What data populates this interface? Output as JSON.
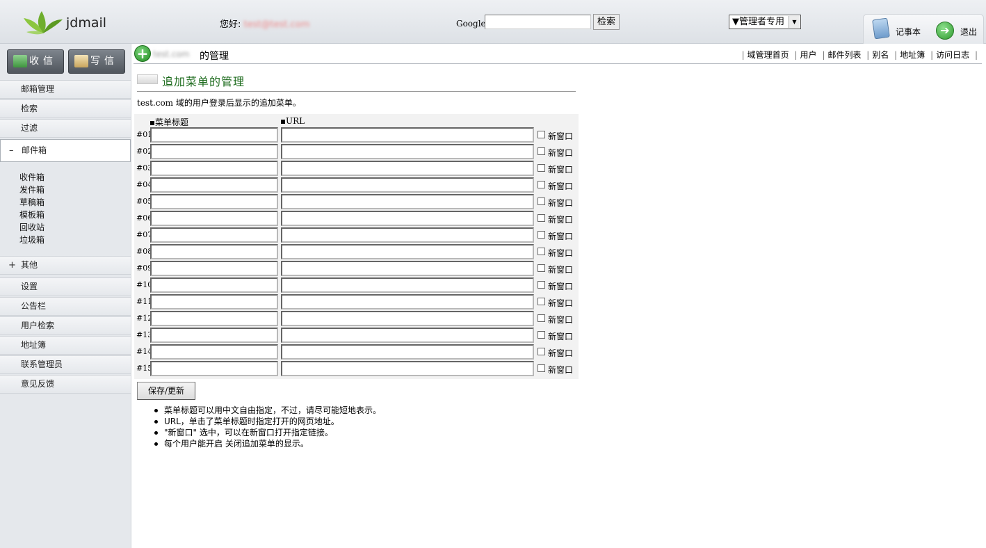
{
  "header": {
    "logo_text": "jdmail",
    "greeting_label": "您好:",
    "user_email": "test@test.com",
    "google_label": "Google",
    "search_button": "检索",
    "admin_select": "▼管理者专用",
    "notepad_label": "记事本",
    "logout_label": "退出"
  },
  "sidebar": {
    "receive_label": "收信",
    "write_label": "写信",
    "items": [
      {
        "label": "邮箱管理"
      },
      {
        "label": "检索"
      },
      {
        "label": "过滤"
      },
      {
        "label": "邮件箱",
        "sign": "–"
      },
      {
        "label": "其他",
        "sign": "+"
      },
      {
        "label": "设置"
      },
      {
        "label": "公告栏"
      },
      {
        "label": "用户检索"
      },
      {
        "label": "地址簿"
      },
      {
        "label": "联系管理员"
      },
      {
        "label": "意见反馈"
      }
    ],
    "folders": [
      "收件箱",
      "发件箱",
      "草稿箱",
      "模板箱",
      "回收站",
      "垃圾箱"
    ]
  },
  "content": {
    "domain": "test.com",
    "head_title": "的管理",
    "links": [
      "域管理首页",
      "用户",
      "邮件列表",
      "别名",
      "地址簿",
      "访问日志"
    ],
    "section_title": "追加菜单的管理",
    "description": "test.com 域的用户登录后显示的追加菜单。",
    "col_title": "菜单标题",
    "col_url": "URL",
    "new_window_label": "新窗口",
    "rows": [
      "#01",
      "#02",
      "#03",
      "#04",
      "#05",
      "#06",
      "#07",
      "#08",
      "#09",
      "#10",
      "#11",
      "#12",
      "#13",
      "#14",
      "#15"
    ],
    "save_button": "保存/更新",
    "notes": [
      "菜单标题可以用中文自由指定，不过，请尽可能短地表示。",
      "URL，单击了菜单标题时指定打开的网页地址。",
      "\"新窗口\" 选中，可以在新窗口打开指定链接。",
      "每个用户能开启 关闭追加菜单的显示。"
    ]
  }
}
